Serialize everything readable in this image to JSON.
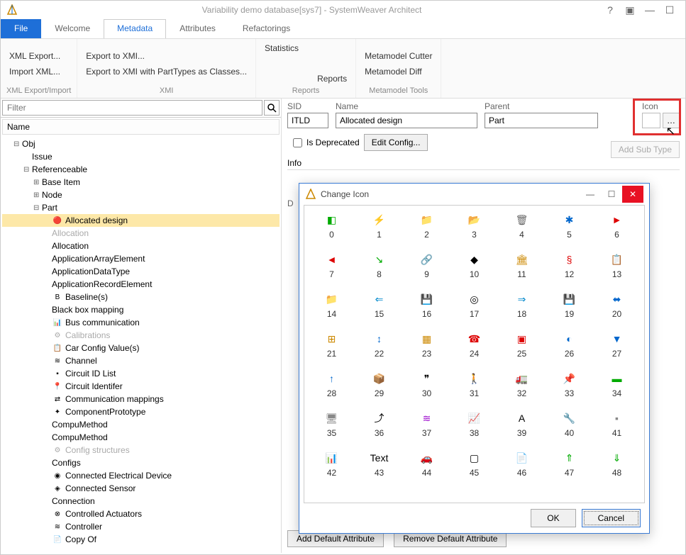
{
  "titlebar": {
    "title": "Variability demo database[sys7] - SystemWeaver Architect"
  },
  "tabs": {
    "file": "File",
    "welcome": "Welcome",
    "metadata": "Metadata",
    "attributes": "Attributes",
    "refactorings": "Refactorings"
  },
  "ribbon": {
    "xml_export_import": {
      "xml_export": "XML Export...",
      "import_xml": "Import XML...",
      "label": "XML Export/Import"
    },
    "xmi": {
      "export_xmi": "Export to XMI...",
      "export_xmi_pt": "Export to XMI with PartTypes as Classes...",
      "label": "XMI"
    },
    "reports": {
      "statistics": "Statistics",
      "reports": "Reports",
      "label": "Reports"
    },
    "metamodel": {
      "cutter": "Metamodel Cutter",
      "diff": "Metamodel Diff",
      "label": "Metamodel Tools"
    }
  },
  "left": {
    "filter_placeholder": "Filter",
    "name_header": "Name",
    "tree": [
      {
        "lvl": 1,
        "exp": "⊟",
        "label": "Obj"
      },
      {
        "lvl": 2,
        "exp": "",
        "label": "Issue"
      },
      {
        "lvl": 2,
        "exp": "⊟",
        "label": "Referenceable"
      },
      {
        "lvl": 3,
        "exp": "⊞",
        "label": "Base Item"
      },
      {
        "lvl": 3,
        "exp": "⊞",
        "label": "Node"
      },
      {
        "lvl": 3,
        "exp": "⊟",
        "label": "Part"
      },
      {
        "lvl": 4,
        "exp": "",
        "label": "Allocated design",
        "sel": true,
        "icon": "🔴"
      },
      {
        "lvl": 4,
        "exp": "",
        "label": "Allocation",
        "dim": true
      },
      {
        "lvl": 4,
        "exp": "",
        "label": "Allocation"
      },
      {
        "lvl": 4,
        "exp": "",
        "label": "ApplicationArrayElement"
      },
      {
        "lvl": 4,
        "exp": "",
        "label": "ApplicationDataType"
      },
      {
        "lvl": 4,
        "exp": "",
        "label": "ApplicationRecordElement"
      },
      {
        "lvl": 4,
        "exp": "",
        "label": "Baseline(s)",
        "icon": "B"
      },
      {
        "lvl": 4,
        "exp": "",
        "label": "Black box mapping"
      },
      {
        "lvl": 4,
        "exp": "",
        "label": "Bus communication",
        "icon": "📊"
      },
      {
        "lvl": 4,
        "exp": "",
        "label": "Calibrations",
        "dim": true,
        "icon": "⚙"
      },
      {
        "lvl": 4,
        "exp": "",
        "label": "Car Config Value(s)",
        "icon": "📋"
      },
      {
        "lvl": 4,
        "exp": "",
        "label": "Channel",
        "icon": "≋"
      },
      {
        "lvl": 4,
        "exp": "",
        "label": "Circuit ID List",
        "icon": "▪"
      },
      {
        "lvl": 4,
        "exp": "",
        "label": "Circuit Identifer",
        "icon": "📍"
      },
      {
        "lvl": 4,
        "exp": "",
        "label": "Communication mappings",
        "icon": "⇄"
      },
      {
        "lvl": 4,
        "exp": "",
        "label": "ComponentPrototype",
        "icon": "✦"
      },
      {
        "lvl": 4,
        "exp": "",
        "label": "CompuMethod"
      },
      {
        "lvl": 4,
        "exp": "",
        "label": "CompuMethod"
      },
      {
        "lvl": 4,
        "exp": "",
        "label": "Config structures",
        "dim": true,
        "icon": "⚙"
      },
      {
        "lvl": 4,
        "exp": "",
        "label": "Configs"
      },
      {
        "lvl": 4,
        "exp": "",
        "label": "Connected Electrical Device",
        "icon": "◉"
      },
      {
        "lvl": 4,
        "exp": "",
        "label": "Connected Sensor",
        "icon": "◈"
      },
      {
        "lvl": 4,
        "exp": "",
        "label": "Connection"
      },
      {
        "lvl": 4,
        "exp": "",
        "label": "Controlled Actuators",
        "icon": "⊗"
      },
      {
        "lvl": 4,
        "exp": "",
        "label": "Controller",
        "icon": "≋"
      },
      {
        "lvl": 4,
        "exp": "",
        "label": "Copy Of",
        "icon": "📄"
      }
    ]
  },
  "form": {
    "sid_label": "SID",
    "sid_value": "ITLD",
    "name_label": "Name",
    "name_value": "Allocated design",
    "parent_label": "Parent",
    "parent_value": "Part",
    "icon_label": "Icon",
    "is_deprecated": "Is Deprecated",
    "edit_config": "Edit Config...",
    "add_subtype": "Add Sub Type",
    "info": "Info",
    "d_prefix": "D",
    "add_default_attr": "Add Default Attribute",
    "remove_default_attr": "Remove Default Attribute"
  },
  "dialog": {
    "title": "Change Icon",
    "ok": "OK",
    "cancel": "Cancel",
    "icons": [
      {
        "n": 0,
        "g": "◧",
        "c": "#0a0"
      },
      {
        "n": 1,
        "g": "⚡",
        "c": "#d00"
      },
      {
        "n": 2,
        "g": "📁",
        "c": "#cc0"
      },
      {
        "n": 3,
        "g": "📂",
        "c": "#cc0"
      },
      {
        "n": 4,
        "g": "🗑",
        "c": "#666"
      },
      {
        "n": 5,
        "g": "✱",
        "c": "#06c"
      },
      {
        "n": 6,
        "g": "►",
        "c": "#d00"
      },
      {
        "n": 7,
        "g": "◄",
        "c": "#d00"
      },
      {
        "n": 8,
        "g": "↘",
        "c": "#0a0"
      },
      {
        "n": 9,
        "g": "🔗",
        "c": "#888"
      },
      {
        "n": 10,
        "g": "◆",
        "c": "#000"
      },
      {
        "n": 11,
        "g": "🏛",
        "c": "#c80"
      },
      {
        "n": 12,
        "g": "§",
        "c": "#d00"
      },
      {
        "n": 13,
        "g": "📋",
        "c": "#888"
      },
      {
        "n": 14,
        "g": "📁",
        "c": "#cc0"
      },
      {
        "n": 15,
        "g": "⇐",
        "c": "#08c"
      },
      {
        "n": 16,
        "g": "💾",
        "c": "#06c"
      },
      {
        "n": 17,
        "g": "◎",
        "c": "#000"
      },
      {
        "n": 18,
        "g": "⇒",
        "c": "#08c"
      },
      {
        "n": 19,
        "g": "💾",
        "c": "#04a"
      },
      {
        "n": 20,
        "g": "⬌",
        "c": "#06c"
      },
      {
        "n": 21,
        "g": "⊞",
        "c": "#c80"
      },
      {
        "n": 22,
        "g": "↕",
        "c": "#06c"
      },
      {
        "n": 23,
        "g": "▦",
        "c": "#c80"
      },
      {
        "n": 24,
        "g": "☎",
        "c": "#d00"
      },
      {
        "n": 25,
        "g": "▣",
        "c": "#d00"
      },
      {
        "n": 26,
        "g": "◐",
        "c": "#06c"
      },
      {
        "n": 27,
        "g": "▼",
        "c": "#06c"
      },
      {
        "n": 28,
        "g": "↑",
        "c": "#06c"
      },
      {
        "n": 29,
        "g": "📦",
        "c": "#c80"
      },
      {
        "n": 30,
        "g": "❞",
        "c": "#000"
      },
      {
        "n": 31,
        "g": "🚶",
        "c": "#06c"
      },
      {
        "n": 32,
        "g": "🚛",
        "c": "#c80"
      },
      {
        "n": 33,
        "g": "📌",
        "c": "#d00"
      },
      {
        "n": 34,
        "g": "▬",
        "c": "#0a0"
      },
      {
        "n": 35,
        "g": "🖥",
        "c": "#888"
      },
      {
        "n": 36,
        "g": "⤴",
        "c": "#000"
      },
      {
        "n": 37,
        "g": "≋",
        "c": "#90c"
      },
      {
        "n": 38,
        "g": "📈",
        "c": "#000"
      },
      {
        "n": 39,
        "g": "A",
        "c": "#000"
      },
      {
        "n": 40,
        "g": "🔧",
        "c": "#888"
      },
      {
        "n": 41,
        "g": "▪",
        "c": "#888"
      },
      {
        "n": 42,
        "g": "📊",
        "c": "#888"
      },
      {
        "n": 43,
        "g": "Text",
        "c": "#000"
      },
      {
        "n": 44,
        "g": "🚗",
        "c": "#888"
      },
      {
        "n": 45,
        "g": "▢",
        "c": "#000"
      },
      {
        "n": 46,
        "g": "📄",
        "c": "#06c"
      },
      {
        "n": 47,
        "g": "⇑",
        "c": "#0a0"
      },
      {
        "n": 48,
        "g": "⇓",
        "c": "#0a0"
      }
    ]
  }
}
